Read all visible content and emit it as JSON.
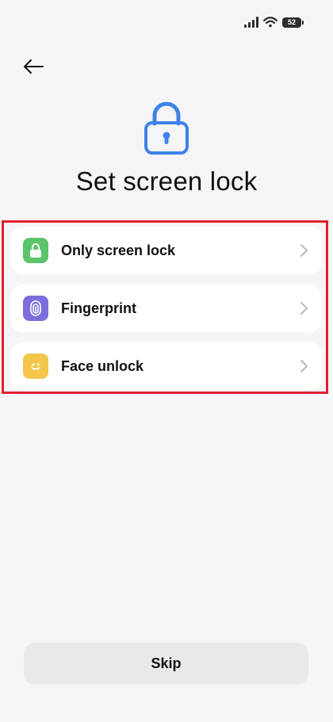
{
  "status_bar": {
    "battery_level": "52"
  },
  "header": {
    "title": "Set screen lock",
    "back_icon": "arrow-left-icon",
    "hero_icon": "lock-icon"
  },
  "options": [
    {
      "label": "Only screen lock",
      "icon": "lock-icon",
      "icon_color": "#5cc46a"
    },
    {
      "label": "Fingerprint",
      "icon": "fingerprint-icon",
      "icon_color": "#7a6fdc"
    },
    {
      "label": "Face unlock",
      "icon": "face-icon",
      "icon_color": "#f2c54b"
    }
  ],
  "footer": {
    "skip_label": "Skip"
  },
  "colors": {
    "background": "#f5f5f7",
    "card": "#ffffff",
    "accent_blue": "#3d82e8",
    "highlight_border": "#e0202d",
    "skip_button": "#e9e9ec"
  }
}
